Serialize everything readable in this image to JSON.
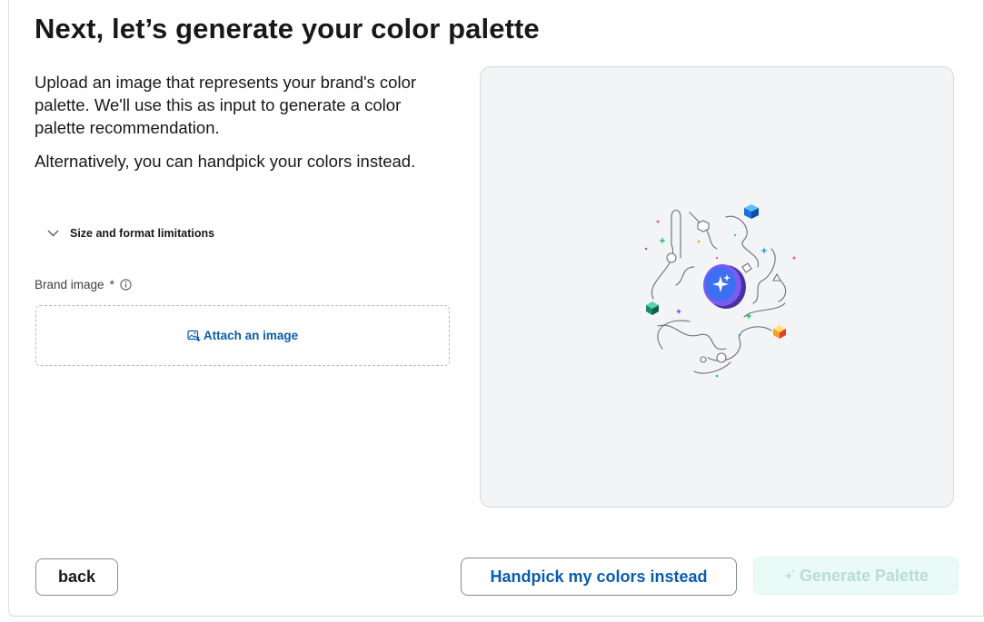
{
  "header": {
    "title": "Next, let’s generate your color palette"
  },
  "intro": {
    "paragraph_1": "Upload an image that represents your brand's color palette. We'll use this as input to generate a color palette recommendation.",
    "paragraph_2": "Alternatively, you can handpick your colors instead."
  },
  "disclosure": {
    "label": "Size and format limitations",
    "icon": "chevron-down-icon"
  },
  "brand_field": {
    "label": "Brand image",
    "required_marker": "*",
    "info_icon": "info-icon"
  },
  "dropzone": {
    "attach_label": "Attach an image",
    "icon": "image-upload-icon"
  },
  "footer": {
    "back_label": "back",
    "handpick_label": "Handpick my colors instead",
    "generate_label": "Generate Palette",
    "generate_icon": "sparkle-icon"
  },
  "colors": {
    "accent_blue": "#0b5cab",
    "generate_bg": "#eafaf7",
    "generate_text": "#b8dcd6",
    "preview_bg": "#f3f4f6"
  }
}
